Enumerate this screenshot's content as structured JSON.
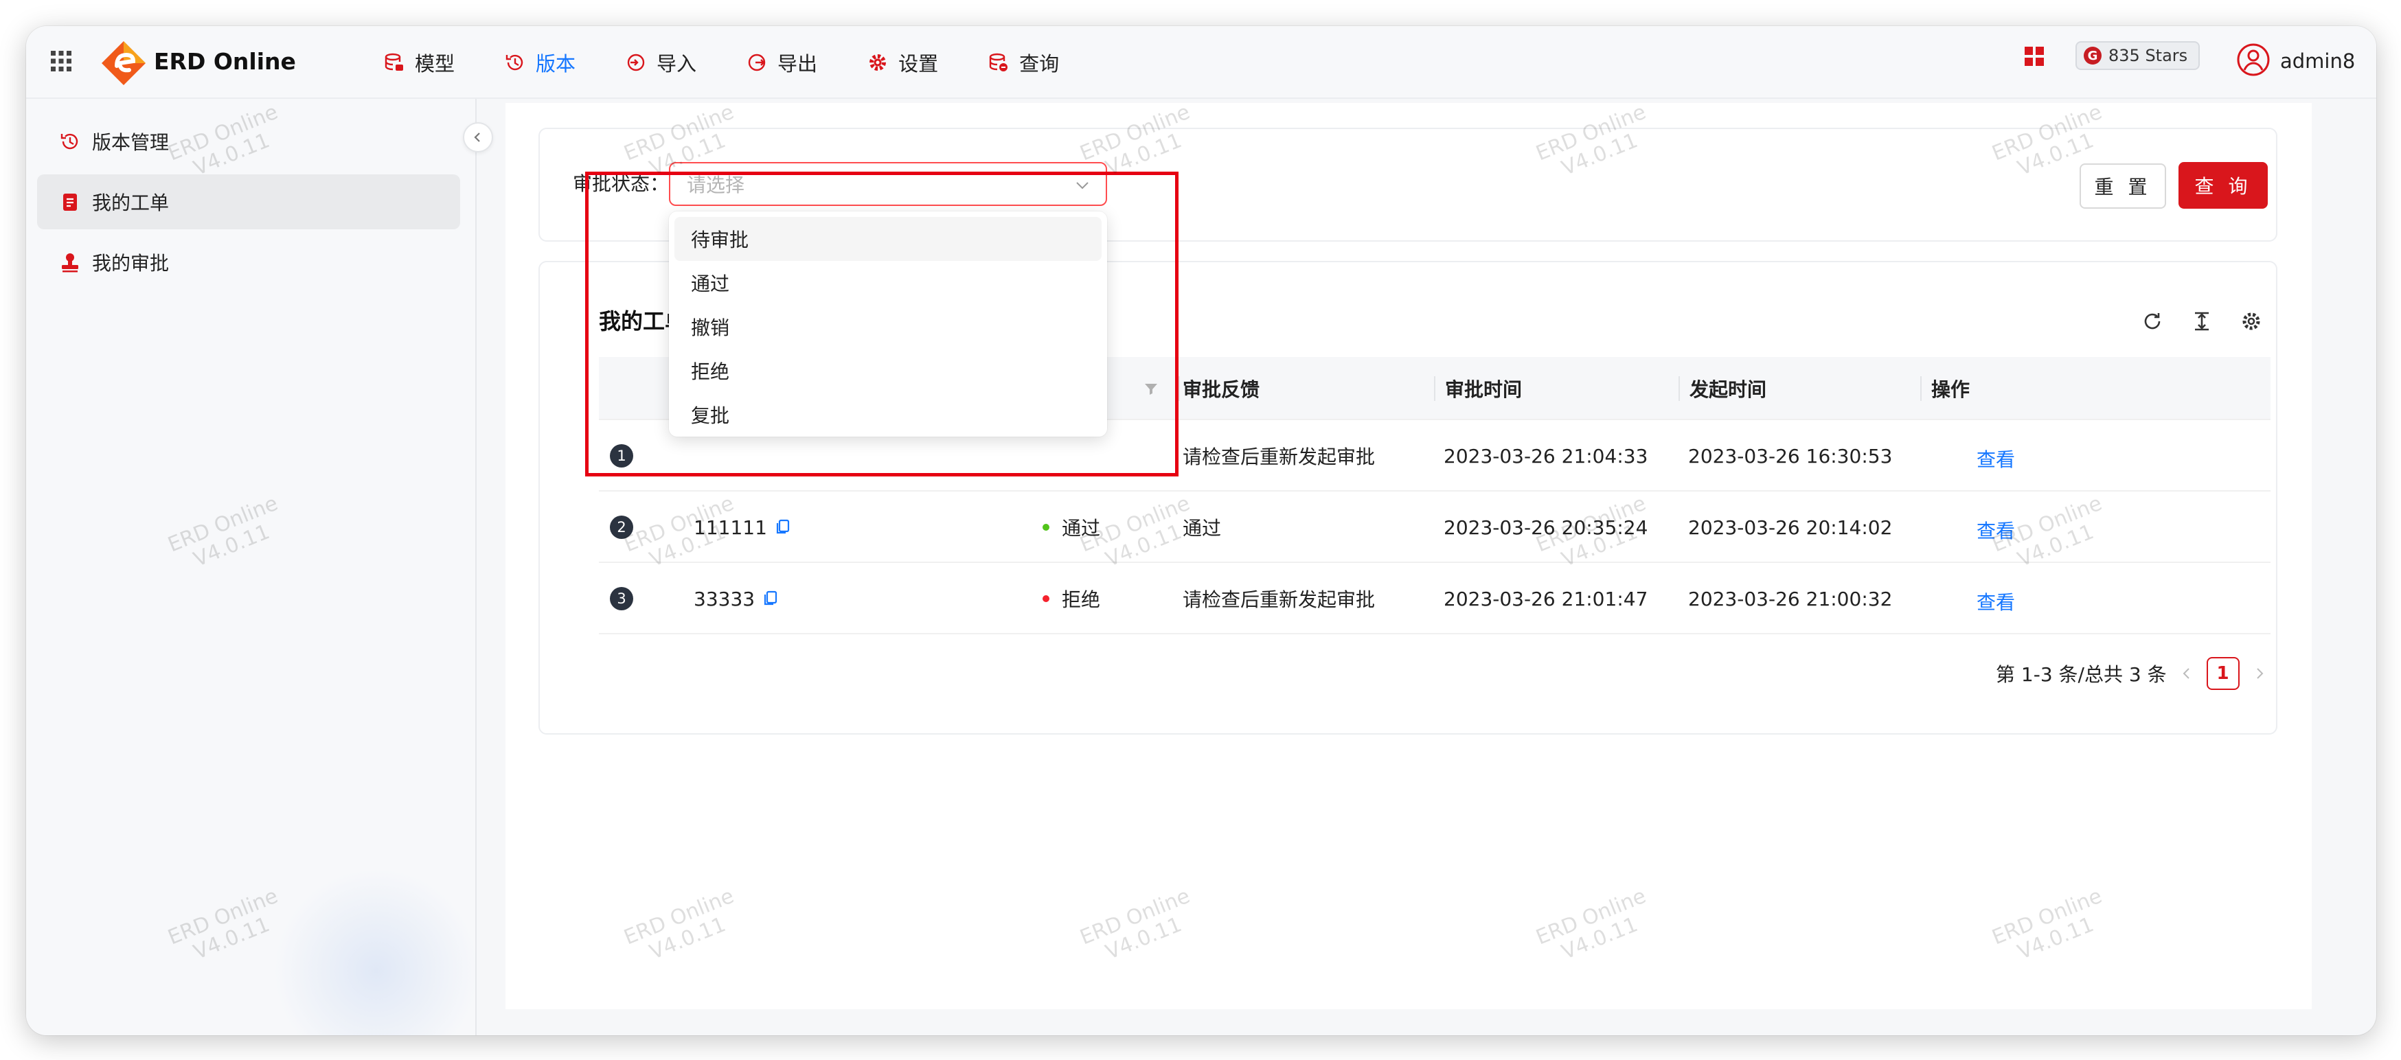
{
  "app": {
    "brand": "ERD Online",
    "stars": "835 Stars",
    "username": "admin8"
  },
  "nav": [
    {
      "label": "模型",
      "icon": "database-icon"
    },
    {
      "label": "版本",
      "icon": "history-icon",
      "active": true
    },
    {
      "label": "导入",
      "icon": "import-icon"
    },
    {
      "label": "导出",
      "icon": "export-icon"
    },
    {
      "label": "设置",
      "icon": "gear-icon"
    },
    {
      "label": "查询",
      "icon": "database-search-icon"
    }
  ],
  "sidebar": {
    "items": [
      {
        "label": "版本管理",
        "icon": "history-icon"
      },
      {
        "label": "我的工单",
        "icon": "clipboard-icon",
        "active": true
      },
      {
        "label": "我的审批",
        "icon": "stamp-icon"
      }
    ]
  },
  "filter": {
    "label": "审批状态：",
    "placeholder": "请选择",
    "options": [
      "待审批",
      "通过",
      "撤销",
      "拒绝",
      "复批"
    ],
    "reset_label": "重 置",
    "query_label": "查 询"
  },
  "table": {
    "title": "我的工单",
    "columns": [
      "审批反馈",
      "审批时间",
      "发起时间",
      "操作"
    ],
    "rows": [
      {
        "index": "1",
        "name": "",
        "status": "",
        "status_color": "",
        "feedback": "请检查后重新发起审批",
        "approve_time": "2023-03-26 21:04:33",
        "start_time": "2023-03-26 16:30:53",
        "action": "查看"
      },
      {
        "index": "2",
        "name": "111111",
        "status": "通过",
        "status_color": "#52c41a",
        "feedback": "通过",
        "approve_time": "2023-03-26 20:35:24",
        "start_time": "2023-03-26 20:14:02",
        "action": "查看"
      },
      {
        "index": "3",
        "name": "33333",
        "status": "拒绝",
        "status_color": "#f5222d",
        "feedback": "请检查后重新发起审批",
        "approve_time": "2023-03-26 21:01:47",
        "start_time": "2023-03-26 21:00:32",
        "action": "查看"
      }
    ]
  },
  "pagination": {
    "summary": "第 1-3 条/总共 3 条",
    "current": "1"
  },
  "watermark": {
    "line1": "ERD Online",
    "line2": "V4.0.11"
  },
  "colors": {
    "primary": "#d9161c",
    "link": "#1677ff",
    "highlight": "#e60012"
  }
}
